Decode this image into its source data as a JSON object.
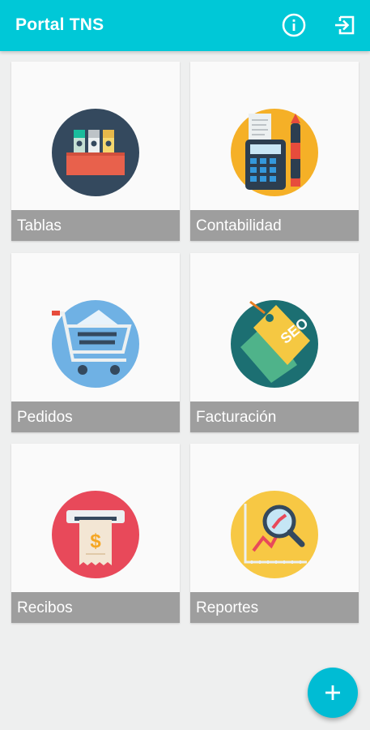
{
  "appbar": {
    "title": "Portal TNS",
    "actions": [
      {
        "icon": "info-icon"
      },
      {
        "icon": "logout-icon"
      }
    ]
  },
  "menu": [
    {
      "label": "Tablas",
      "icon": "binders-icon"
    },
    {
      "label": "Contabilidad",
      "icon": "calculator-icon"
    },
    {
      "label": "Pedidos",
      "icon": "shopping-cart-icon"
    },
    {
      "label": "Facturación",
      "icon": "seo-tag-icon"
    },
    {
      "label": "Recibos",
      "icon": "receipt-icon"
    },
    {
      "label": "Reportes",
      "icon": "chart-search-icon"
    }
  ],
  "fab": {
    "icon": "plus-icon"
  },
  "colors": {
    "primary": "#00c8d7",
    "fab": "#00bcd4",
    "label_bg": "#9e9e9e",
    "background": "#eeefef"
  }
}
